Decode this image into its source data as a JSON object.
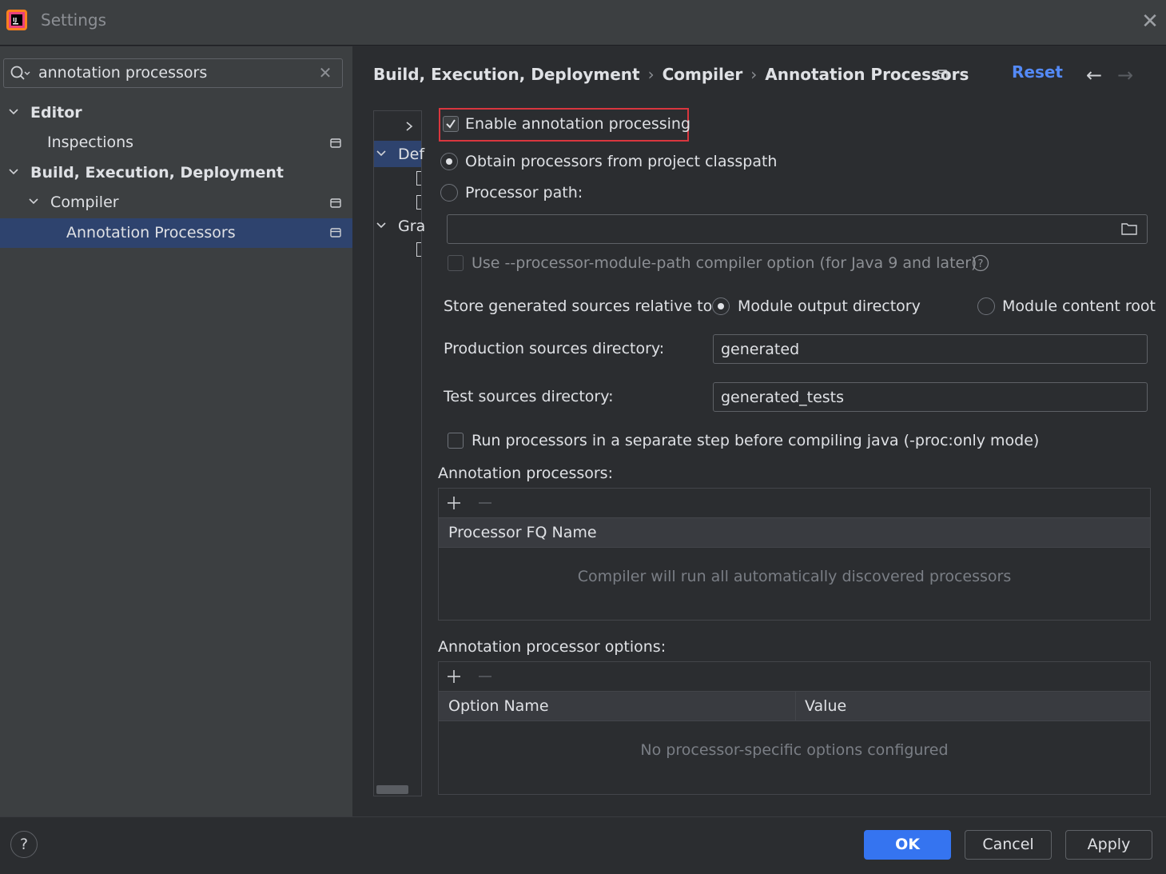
{
  "window": {
    "title": "Settings"
  },
  "search": {
    "value": "annotation processors",
    "placeholder": ""
  },
  "tree": {
    "editor": "Editor",
    "inspections": "Inspections",
    "build": "Build, Execution, Deployment",
    "compiler": "Compiler",
    "annotation_processors": "Annotation Processors"
  },
  "breadcrumb": {
    "items": [
      "Build, Execution, Deployment",
      "Compiler",
      "Annotation Processors"
    ],
    "separator": "›"
  },
  "header": {
    "reset": "Reset"
  },
  "module_tree": {
    "item1": "Def",
    "item2": "Gra"
  },
  "form": {
    "enable_label": "Enable annotation processing",
    "enable_checked": true,
    "obtain_label": "Obtain processors from project classpath",
    "processor_path_label": "Processor path:",
    "processor_path_value": "",
    "module_path_label": "Use --processor-module-path compiler option (for Java 9 and later)",
    "store_label": "Store generated sources relative to:",
    "module_output_label": "Module output directory",
    "module_content_label": "Module content root",
    "production_label": "Production sources directory:",
    "production_value": "generated",
    "test_label": "Test sources directory:",
    "test_value": "generated_tests",
    "run_separate_label": "Run processors in a separate step before compiling java (-proc:only mode)"
  },
  "processors_table": {
    "title": "Annotation processors:",
    "column": "Processor FQ Name",
    "empty": "Compiler will run all automatically discovered processors"
  },
  "options_table": {
    "title": "Annotation processor options:",
    "columns": [
      "Option Name",
      "Value"
    ],
    "empty": "No processor-specific options configured"
  },
  "buttons": {
    "ok": "OK",
    "cancel": "Cancel",
    "apply": "Apply",
    "help": "?"
  },
  "colors": {
    "accent": "#3574f0",
    "link": "#548af7",
    "selection": "#2e436e",
    "highlight_border": "#d9363e"
  }
}
